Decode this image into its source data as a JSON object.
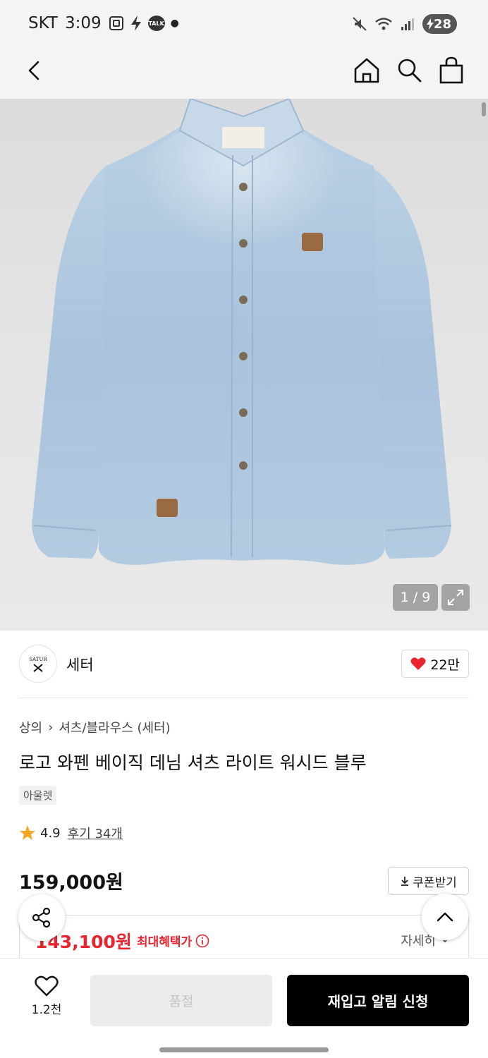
{
  "status_bar": {
    "carrier": "SKT",
    "time": "3:09",
    "talk_badge": "TALK",
    "battery": "28"
  },
  "header": {
    "icons": [
      "back-icon",
      "home-icon",
      "search-icon",
      "cart-icon"
    ]
  },
  "gallery": {
    "counter": "1 / 9"
  },
  "brand": {
    "logo_text": "SATUR",
    "name": "세터",
    "likes": "22만"
  },
  "product": {
    "breadcrumb": [
      "상의",
      "셔츠/블라우스 (세터)"
    ],
    "title": "로고 와펜 베이직 데님 셔츠 라이트 워시드 블루",
    "badge": "아울렛",
    "rating": "4.9",
    "reviews": "후기 34개",
    "price": "159,000원",
    "coupon_label": "쿠폰받기",
    "max_benefit_price": "143,100원",
    "max_benefit_label": "최대혜택가",
    "detail_label": "자세히"
  },
  "bottom_bar": {
    "wish_count": "1.2천",
    "soldout_label": "품절",
    "restock_label": "재입고 알림 신청"
  },
  "colors": {
    "accent_red": "#e8242f",
    "cta_black": "#000000",
    "star": "#f5a623"
  }
}
